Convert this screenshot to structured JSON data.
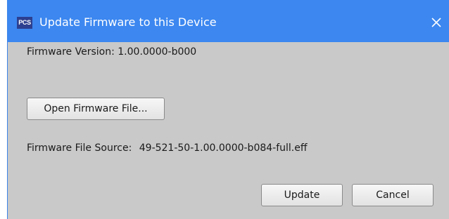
{
  "dialog": {
    "app_icon_text": "PCS",
    "title": "Update Firmware to this Device",
    "close_icon": "close-icon"
  },
  "firmware_version": {
    "label": "Firmware Version:",
    "value": "1.00.0000-b000"
  },
  "open_button_label": "Open Firmware File...",
  "firmware_source": {
    "label": "Firmware File Source:",
    "value": "49-521-50-1.00.0000-b084-full.eff"
  },
  "buttons": {
    "update_label": "Update",
    "cancel_label": "Cancel"
  },
  "colors": {
    "titlebar": "#3c87f0",
    "dialog_background": "#c9c9c9"
  }
}
